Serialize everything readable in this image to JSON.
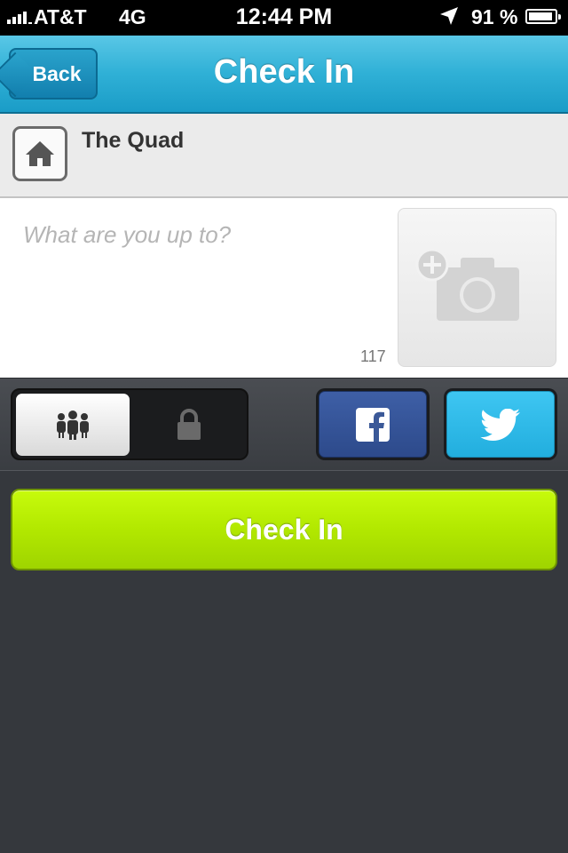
{
  "status_bar": {
    "carrier": "AT&T",
    "network": "4G",
    "time": "12:44 PM",
    "battery_percent": "91 %"
  },
  "nav": {
    "back_label": "Back",
    "title": "Check In"
  },
  "venue": {
    "icon": "home-icon",
    "name": "The Quad"
  },
  "compose": {
    "placeholder": "What are you up to?",
    "char_count": "117",
    "photo_icon": "add-photo-icon"
  },
  "toolbar": {
    "privacy_options": [
      {
        "icon": "people-icon",
        "selected": true
      },
      {
        "icon": "lock-icon",
        "selected": false
      }
    ],
    "share_facebook_icon": "facebook-icon",
    "share_twitter_icon": "twitter-icon"
  },
  "checkin_button": {
    "label": "Check In"
  },
  "colors": {
    "nav_blue": "#2fb0d6",
    "checkin_green": "#b2e800",
    "facebook_blue": "#3b5998",
    "twitter_blue": "#2fbdec",
    "background_dark": "#35383d"
  }
}
